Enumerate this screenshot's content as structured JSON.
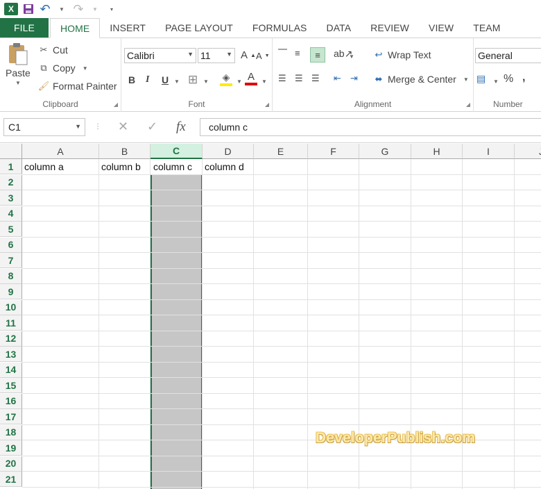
{
  "quick_access": {
    "app_icon": "X",
    "save_icon": "save-icon",
    "undo_icon": "undo-icon",
    "redo_icon": "redo-icon",
    "customize_icon": "customize-icon"
  },
  "tabs": [
    {
      "label": "FILE"
    },
    {
      "label": "HOME"
    },
    {
      "label": "INSERT"
    },
    {
      "label": "PAGE LAYOUT"
    },
    {
      "label": "FORMULAS"
    },
    {
      "label": "DATA"
    },
    {
      "label": "REVIEW"
    },
    {
      "label": "VIEW"
    },
    {
      "label": "TEAM"
    }
  ],
  "ribbon": {
    "clipboard": {
      "paste_label": "Paste",
      "cut_label": "Cut",
      "copy_label": "Copy",
      "format_painter_label": "Format Painter",
      "group_label": "Clipboard"
    },
    "font": {
      "font_name": "Calibri",
      "font_size": "11",
      "bold": "B",
      "italic": "I",
      "underline": "U",
      "group_label": "Font"
    },
    "alignment": {
      "wrap_text_label": "Wrap Text",
      "merge_center_label": "Merge & Center",
      "group_label": "Alignment"
    },
    "number": {
      "format_value": "General",
      "percent": "%",
      "comma": ",",
      "group_label": "Number"
    }
  },
  "formula_bar": {
    "name_box": "C1",
    "fx": "fx",
    "content": "column c"
  },
  "grid": {
    "columns": [
      "A",
      "B",
      "C",
      "D",
      "E",
      "F",
      "G",
      "H",
      "I",
      "J"
    ],
    "selected_column": "C",
    "rows": [
      "1",
      "2",
      "3",
      "4",
      "5",
      "6",
      "7",
      "8",
      "9",
      "10",
      "11",
      "12",
      "13",
      "14",
      "15",
      "16",
      "17",
      "18",
      "19",
      "20",
      "21"
    ],
    "cells": {
      "A1": "column a",
      "B1": "column b",
      "C1": "column c",
      "D1": "column d"
    }
  },
  "watermark": "DeveloperPublish.com",
  "colors": {
    "accent": "#217346",
    "selected_column_fill": "#c6c6c6",
    "font_color_bar": "#e00000",
    "highlight_bar": "#ffeb00"
  }
}
